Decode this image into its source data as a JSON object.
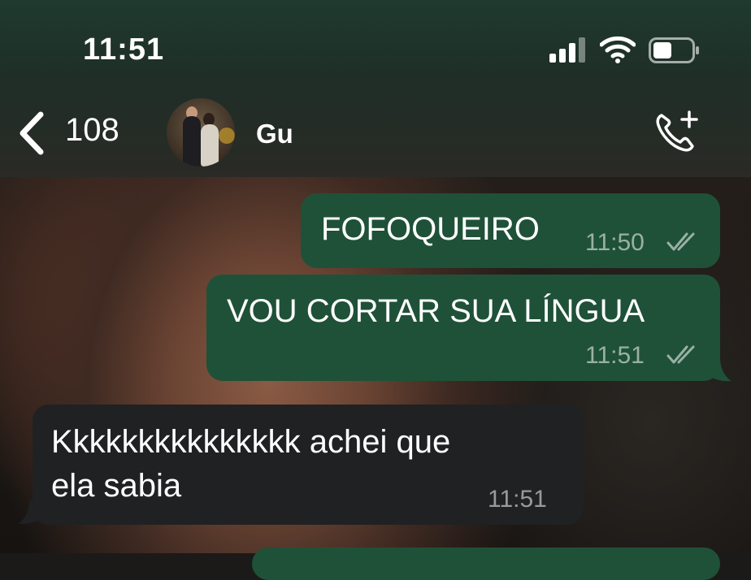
{
  "status_bar": {
    "time": "11:51",
    "signal_icon": "cellular-signal-icon",
    "wifi_icon": "wifi-icon",
    "battery_icon": "battery-icon",
    "battery_level": 0.4
  },
  "header": {
    "back_icon": "chevron-left-icon",
    "back_count": "108",
    "contact_name": "Gu",
    "call_icon": "phone-add-icon"
  },
  "messages": [
    {
      "direction": "outgoing",
      "text": "FOFOQUEIRO",
      "time": "11:50",
      "status": "read"
    },
    {
      "direction": "outgoing",
      "text": "VOU CORTAR SUA LÍNGUA",
      "time": "11:51",
      "status": "read"
    },
    {
      "direction": "incoming",
      "text_line1": "Kkkkkkkkkkkkkkk achei que",
      "text_line2": "ela sabia",
      "time": "11:51"
    }
  ],
  "colors": {
    "outgoing_bubble": "#1f5138",
    "incoming_bubble": "#202123",
    "header": "#1f3a30"
  }
}
